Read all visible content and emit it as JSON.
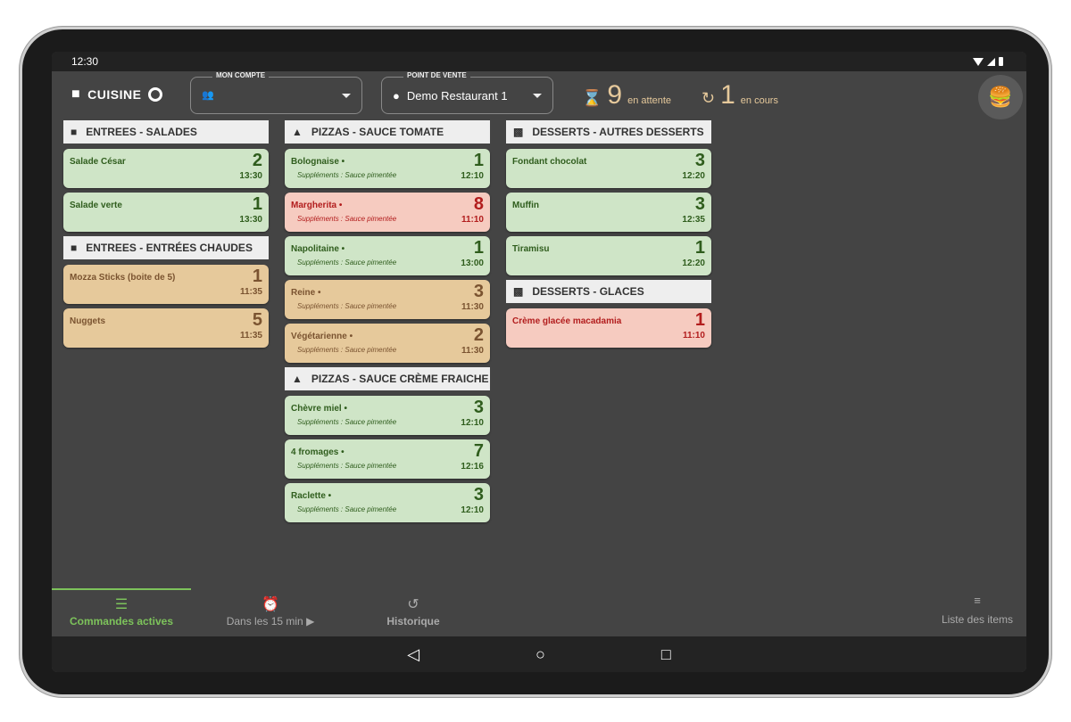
{
  "status_bar": {
    "time": "12:30"
  },
  "header": {
    "title": "CUISINE",
    "account_label": "MON COMPTE",
    "account_value": "",
    "pos_label": "POINT DE VENTE",
    "pos_value": "Demo Restaurant 1",
    "waiting_count": "9",
    "waiting_label": "en attente",
    "progress_count": "1",
    "progress_label": "en cours"
  },
  "colors": {
    "green": "#cfe5c7",
    "red": "#f6cbc0",
    "orange": "#e6c99b",
    "accent": "#7dc35b",
    "background": "#444444"
  },
  "columns": [
    [
      {
        "title": "ENTREES - SALADES",
        "icon": "chef-hat-icon",
        "items": [
          {
            "name": "Salade César",
            "qty": "2",
            "time": "13:30",
            "status": "green"
          },
          {
            "name": "Salade verte",
            "qty": "1",
            "time": "13:30",
            "status": "green"
          }
        ]
      },
      {
        "title": "ENTREES - ENTRÉES CHAUDES",
        "icon": "chef-hat-icon",
        "items": [
          {
            "name": "Mozza Sticks (boite de 5)",
            "qty": "1",
            "time": "11:35",
            "status": "orange"
          },
          {
            "name": "Nuggets",
            "qty": "5",
            "time": "11:35",
            "status": "orange"
          }
        ]
      }
    ],
    [
      {
        "title": "PIZZAS - SAUCE TOMATE",
        "icon": "cloche-icon",
        "items": [
          {
            "name": "Bolognaise •",
            "sup": "Suppléments : Sauce pimentée",
            "qty": "1",
            "time": "12:10",
            "status": "green"
          },
          {
            "name": "Margherita •",
            "sup": "Suppléments : Sauce pimentée",
            "qty": "8",
            "time": "11:10",
            "status": "red"
          },
          {
            "name": "Napolitaine •",
            "sup": "Suppléments : Sauce pimentée",
            "qty": "1",
            "time": "13:00",
            "status": "green"
          },
          {
            "name": "Reine •",
            "sup": "Suppléments : Sauce pimentée",
            "qty": "3",
            "time": "11:30",
            "status": "orange"
          },
          {
            "name": "Végétarienne •",
            "sup": "Suppléments : Sauce pimentée",
            "qty": "2",
            "time": "11:30",
            "status": "orange"
          }
        ]
      },
      {
        "title": "PIZZAS - SAUCE CRÈME FRAICHE",
        "icon": "cloche-icon",
        "items": [
          {
            "name": "Chèvre miel •",
            "sup": "Suppléments : Sauce pimentée",
            "qty": "3",
            "time": "12:10",
            "status": "green"
          },
          {
            "name": "4 fromages •",
            "sup": "Suppléments : Sauce pimentée",
            "qty": "7",
            "time": "12:16",
            "status": "green"
          },
          {
            "name": "Raclette •",
            "sup": "Suppléments : Sauce pimentée",
            "qty": "3",
            "time": "12:10",
            "status": "green"
          }
        ]
      }
    ],
    [
      {
        "title": "DESSERTS - AUTRES DESSERTS",
        "icon": "cake-icon",
        "items": [
          {
            "name": "Fondant chocolat",
            "qty": "3",
            "time": "12:20",
            "status": "green"
          },
          {
            "name": "Muffin",
            "qty": "3",
            "time": "12:35",
            "status": "green"
          },
          {
            "name": "Tiramisu",
            "qty": "1",
            "time": "12:20",
            "status": "green"
          }
        ]
      },
      {
        "title": "DESSERTS - GLACES",
        "icon": "cake-icon",
        "items": [
          {
            "name": "Crème glacée macadamia",
            "qty": "1",
            "time": "11:10",
            "status": "red"
          }
        ]
      }
    ]
  ],
  "bottom_nav": {
    "active": "Commandes actives",
    "soon": "Dans les 15 min",
    "history": "Historique",
    "items_list": "Liste des items"
  }
}
